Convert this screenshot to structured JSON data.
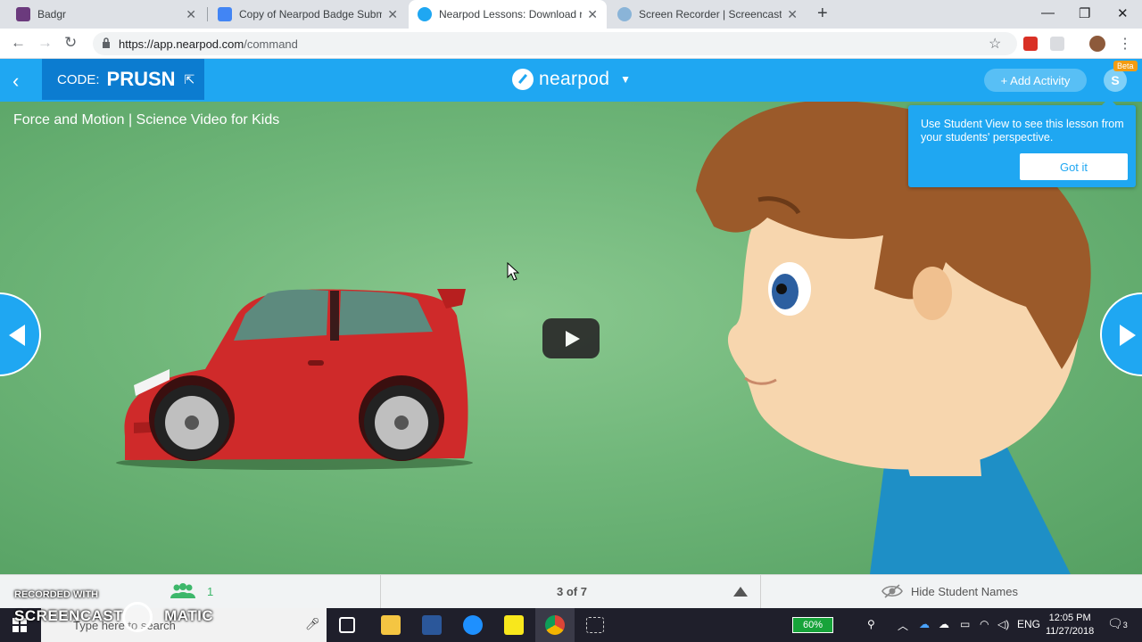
{
  "browser": {
    "tabs": [
      {
        "title": "Badgr",
        "active": false
      },
      {
        "title": "Copy of Nearpod Badge Submis",
        "active": false
      },
      {
        "title": "Nearpod Lessons: Download rea",
        "active": true
      },
      {
        "title": "Screen Recorder | Screencast-O-",
        "active": false
      }
    ],
    "url_host": "https://app.nearpod.com",
    "url_path": "/command"
  },
  "nearpod": {
    "code_label": "CODE:",
    "code_value": "PRUSN",
    "logo_text": "nearpod",
    "add_activity": "+ Add Activity",
    "student_view_letter": "S",
    "beta": "Beta"
  },
  "video": {
    "title": "Force and Motion | Science Video for Kids"
  },
  "tooltip": {
    "text": "Use Student View to see this lesson from your students' perspective.",
    "button": "Got it"
  },
  "bottombar": {
    "student_count": "1",
    "slide_position": "3 of 7",
    "hide_names": "Hide Student Names"
  },
  "taskbar": {
    "search_placeholder": "Type here to search",
    "battery": "60%",
    "language": "ENG",
    "time": "12:05 PM",
    "date": "11/27/2018",
    "notifications": "3"
  },
  "watermark": {
    "line1": "RECORDED WITH",
    "line2": "SCREENCAST",
    "line3": "MATIC"
  },
  "colors": {
    "nearpod_blue": "#1fa7f2",
    "code_box": "#0c7cd0",
    "student_green": "#3db76a"
  }
}
